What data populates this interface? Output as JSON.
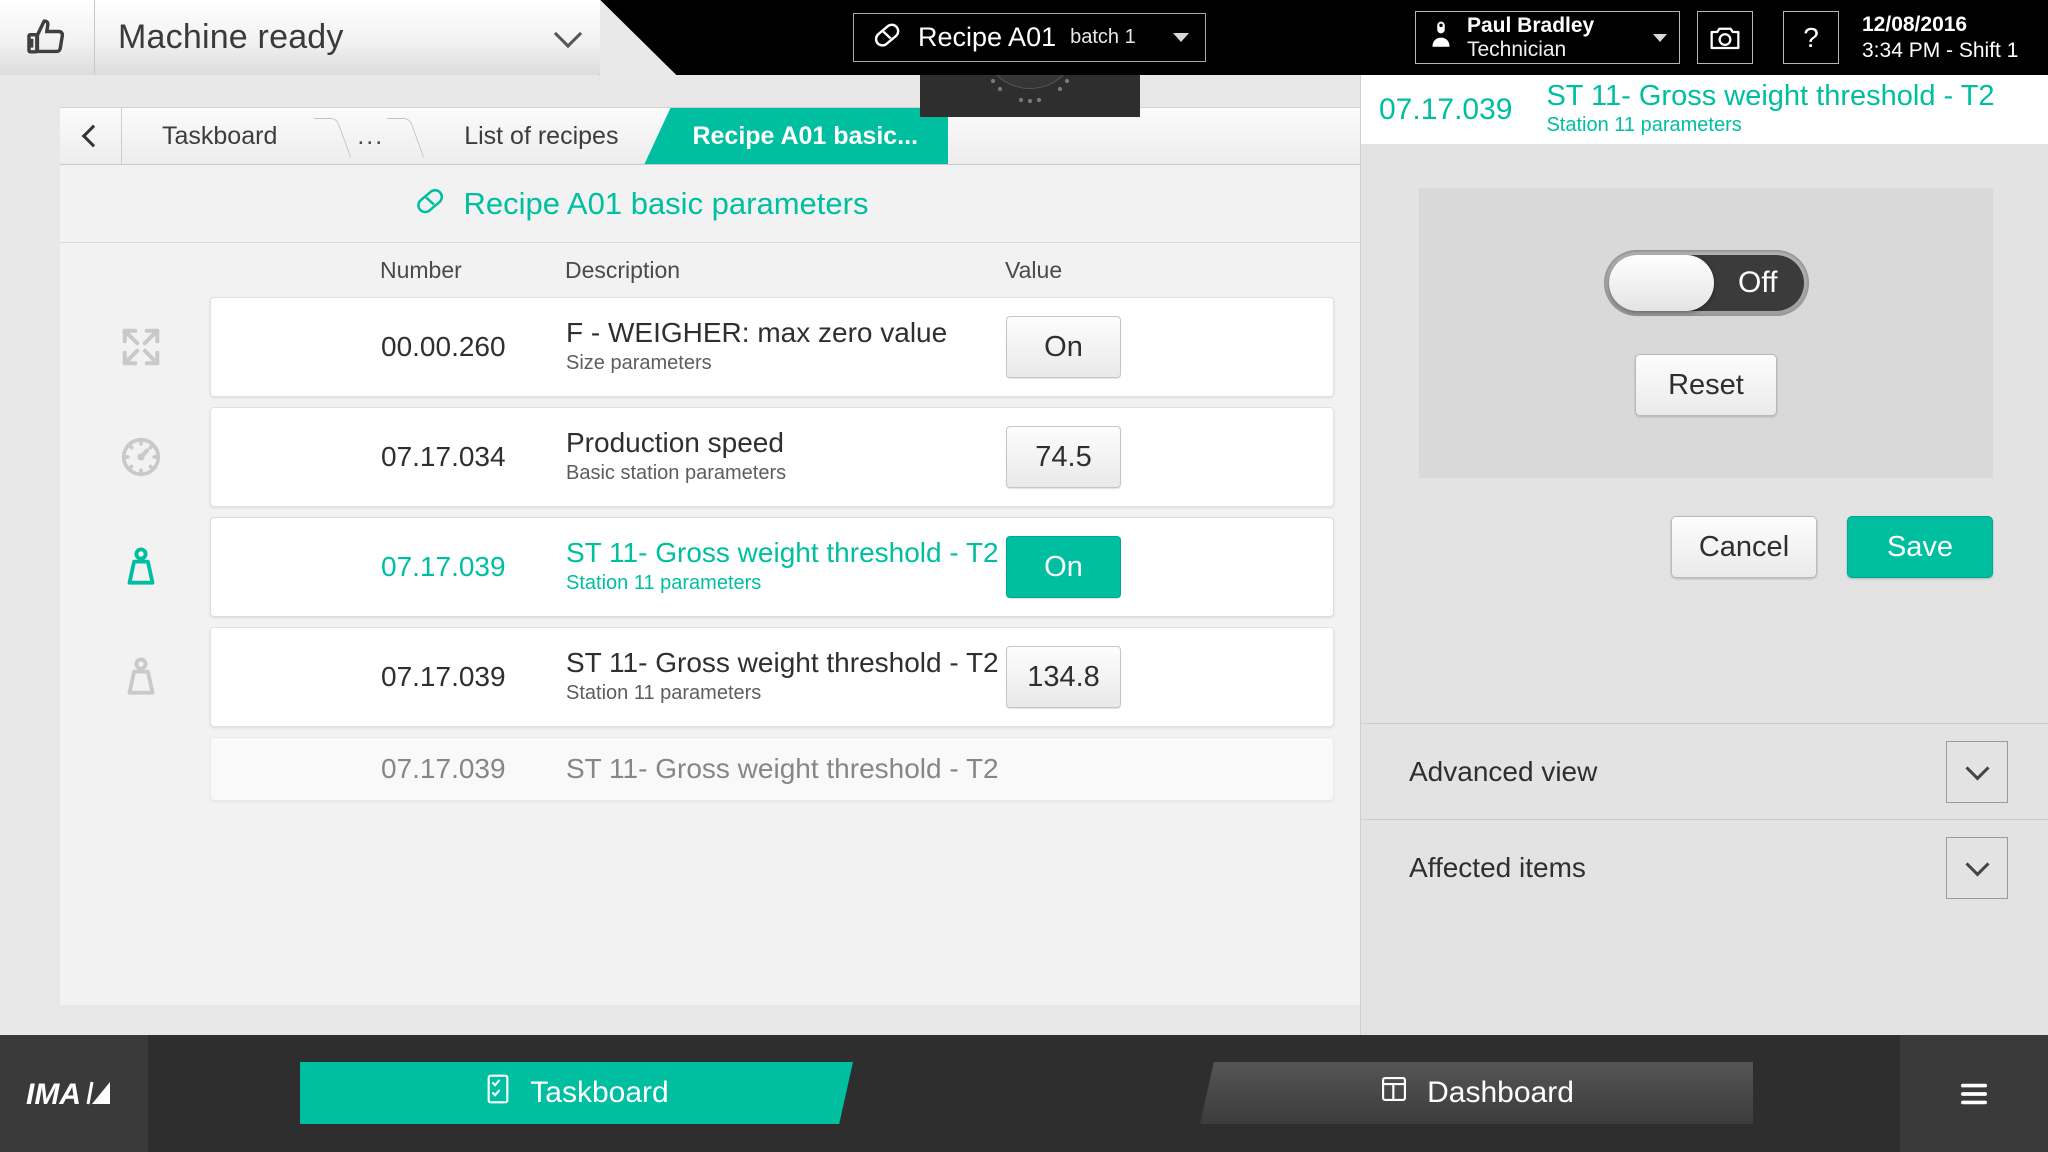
{
  "topbar": {
    "machine_status": "Machine ready",
    "status_icon": "thumbs-up-icon",
    "recipe": {
      "icon": "capsule-icon",
      "name": "Recipe A01",
      "batch": "batch 1"
    },
    "user": {
      "icon": "user-icon",
      "name": "Paul Bradley",
      "role": "Technician"
    },
    "camera_icon": "camera-icon",
    "help_label": "?",
    "datetime": {
      "date": "12/08/2016",
      "time_shift": "3:34 PM - Shift 1"
    }
  },
  "breadcrumb": {
    "back_icon": "chevron-left-icon",
    "items": [
      {
        "label": "Taskboard",
        "active": false
      },
      {
        "label": "...",
        "active": false
      },
      {
        "label": "List of recipes",
        "active": false
      },
      {
        "label": "Recipe A01 basic...",
        "active": true
      }
    ]
  },
  "page": {
    "title": "Recipe A01 basic parameters",
    "title_icon": "capsule-icon"
  },
  "table": {
    "headers": {
      "number": "Number",
      "description": "Description",
      "value": "Value"
    },
    "rows": [
      {
        "icon": "expand-arrows-icon",
        "number": "00.00.260",
        "description": "F - WEIGHER: max zero value",
        "subtitle": "Size parameters",
        "value": "On",
        "selected": false
      },
      {
        "icon": "speedometer-icon",
        "number": "07.17.034",
        "description": "Production speed",
        "subtitle": "Basic station parameters",
        "value": "74.5",
        "selected": false
      },
      {
        "icon": "weight-icon",
        "number": "07.17.039",
        "description": "ST 11- Gross weight threshold - T2",
        "subtitle": "Station 11 parameters",
        "value": "On",
        "selected": true
      },
      {
        "icon": "weight-icon",
        "number": "07.17.039",
        "description": "ST 11- Gross weight threshold - T2",
        "subtitle": "Station 11 parameters",
        "value": "134.8",
        "selected": false
      },
      {
        "icon": "weight-icon",
        "number": "07.17.039",
        "description": "ST 11- Gross weight threshold - T2",
        "subtitle": "",
        "value": "",
        "selected": false
      }
    ]
  },
  "detail_panel": {
    "number": "07.17.039",
    "title": "ST 11- Gross weight threshold - T2",
    "subtitle": "Station 11 parameters",
    "toggle": {
      "state_label": "Off",
      "on": false
    },
    "reset_label": "Reset",
    "cancel_label": "Cancel",
    "save_label": "Save",
    "accordions": [
      {
        "label": "Advanced view",
        "icon": "chevron-down-icon"
      },
      {
        "label": "Affected items",
        "icon": "chevron-down-icon"
      }
    ]
  },
  "bottombar": {
    "logo": "IMA",
    "taskboard": {
      "label": "Taskboard",
      "icon": "checklist-icon"
    },
    "dashboard": {
      "label": "Dashboard",
      "icon": "dashboard-icon"
    },
    "play_icon": "play-icon",
    "up_icon": "chevron-up-icon",
    "menu_icon": "hamburger-menu-icon"
  },
  "colors": {
    "accent": "#00bfa0",
    "topbar_bg": "#000000",
    "bottombar_bg": "#2e2e2e",
    "panel_bg": "#e3e3e3"
  }
}
